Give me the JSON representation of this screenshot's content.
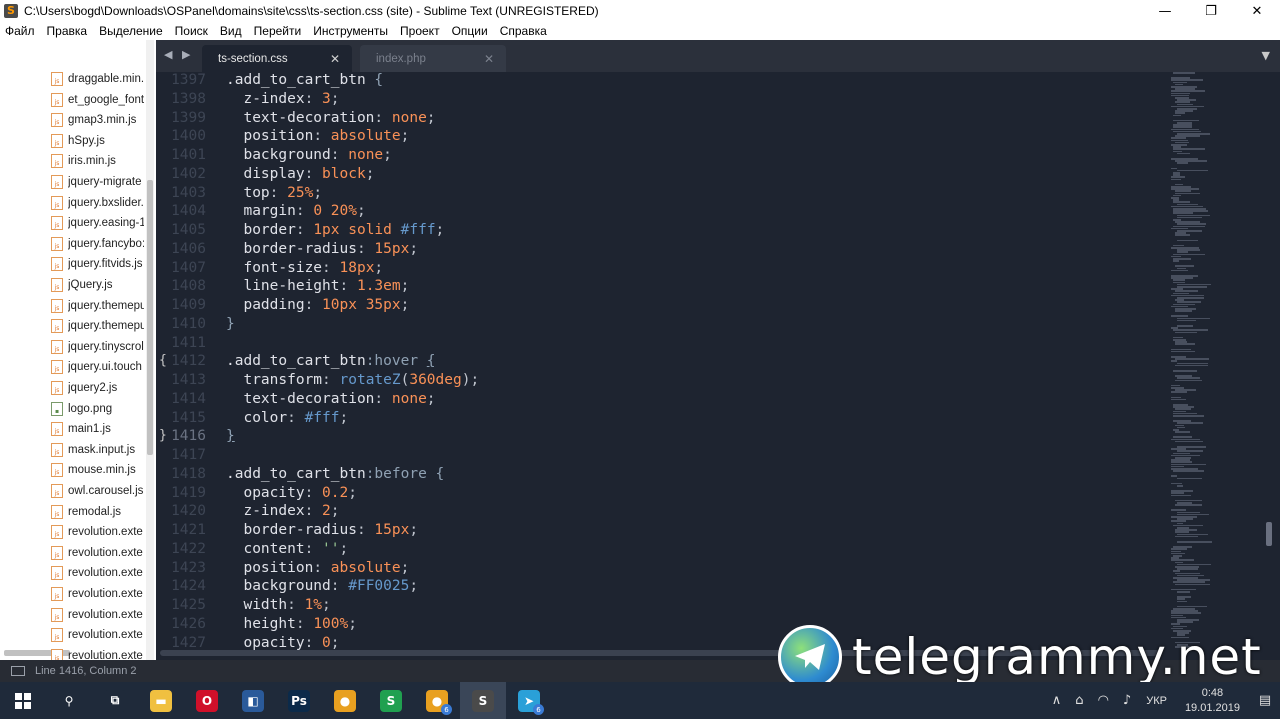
{
  "window": {
    "title": "C:\\Users\\bogd\\Downloads\\OSPanel\\domains\\site\\css\\ts-section.css (site) - Sublime Text (UNREGISTERED)",
    "minimize": "—",
    "maximize": "❐",
    "close": "✕"
  },
  "menu": [
    "Файл",
    "Правка",
    "Выделение",
    "Поиск",
    "Вид",
    "Перейти",
    "Инструменты",
    "Проект",
    "Опции",
    "Справка"
  ],
  "sidebar": {
    "files": [
      {
        "name": "draggable.min.",
        "type": "js"
      },
      {
        "name": "et_google_font",
        "type": "js"
      },
      {
        "name": "gmap3.min.js",
        "type": "js"
      },
      {
        "name": "hSpy.js",
        "type": "js"
      },
      {
        "name": "iris.min.js",
        "type": "js"
      },
      {
        "name": "jquery-migrate",
        "type": "js"
      },
      {
        "name": "jquery.bxslider.",
        "type": "js"
      },
      {
        "name": "jquery.easing-1",
        "type": "js"
      },
      {
        "name": "jquery.fancybo:",
        "type": "js"
      },
      {
        "name": "jquery.fitvids.js",
        "type": "js"
      },
      {
        "name": "jQuery.js",
        "type": "js"
      },
      {
        "name": "jquery.themepu",
        "type": "js"
      },
      {
        "name": "jquery.themepu",
        "type": "js"
      },
      {
        "name": "jquery.tinyscrol",
        "type": "js"
      },
      {
        "name": "jquery.ui.touch",
        "type": "js"
      },
      {
        "name": "jquery2.js",
        "type": "js"
      },
      {
        "name": "logo.png",
        "type": "img"
      },
      {
        "name": "main1.js",
        "type": "js"
      },
      {
        "name": "mask.input.js",
        "type": "js"
      },
      {
        "name": "mouse.min.js",
        "type": "js"
      },
      {
        "name": "owl.carousel.js",
        "type": "js"
      },
      {
        "name": "remodal.js",
        "type": "js"
      },
      {
        "name": "revolution.exte",
        "type": "js"
      },
      {
        "name": "revolution.exte",
        "type": "js"
      },
      {
        "name": "revolution.exte",
        "type": "js"
      },
      {
        "name": "revolution.exte",
        "type": "js"
      },
      {
        "name": "revolution.exte",
        "type": "js"
      },
      {
        "name": "revolution.exte",
        "type": "js"
      },
      {
        "name": "revolution.exte",
        "type": "js"
      }
    ]
  },
  "tabs": {
    "nav": "◀ ▶",
    "active": "ts-section.css",
    "inactive": "index.php",
    "close": "✕",
    "dropdown": "▼"
  },
  "editor": {
    "lines": [
      {
        "n": "1397",
        "tokens": [
          {
            "t": ".add_to_cart_btn ",
            "c": "t-sel"
          },
          {
            "t": "{",
            "c": "t-brace"
          }
        ]
      },
      {
        "n": "1398",
        "tokens": [
          {
            "t": "  z-index",
            "c": "t-prop"
          },
          {
            "t": ": ",
            "c": "t-punc"
          },
          {
            "t": "3",
            "c": "t-val"
          },
          {
            "t": ";",
            "c": "t-punc"
          }
        ]
      },
      {
        "n": "1399",
        "tokens": [
          {
            "t": "  text-decoration",
            "c": "t-prop"
          },
          {
            "t": ": ",
            "c": "t-punc"
          },
          {
            "t": "none",
            "c": "t-val"
          },
          {
            "t": ";",
            "c": "t-punc"
          }
        ]
      },
      {
        "n": "1400",
        "tokens": [
          {
            "t": "  position",
            "c": "t-prop"
          },
          {
            "t": ": ",
            "c": "t-punc"
          },
          {
            "t": "absolute",
            "c": "t-val"
          },
          {
            "t": ";",
            "c": "t-punc"
          }
        ]
      },
      {
        "n": "1401",
        "tokens": [
          {
            "t": "  background",
            "c": "t-prop"
          },
          {
            "t": ": ",
            "c": "t-punc"
          },
          {
            "t": "none",
            "c": "t-val"
          },
          {
            "t": ";",
            "c": "t-punc"
          }
        ]
      },
      {
        "n": "1402",
        "tokens": [
          {
            "t": "  display",
            "c": "t-prop"
          },
          {
            "t": ": ",
            "c": "t-punc"
          },
          {
            "t": "block",
            "c": "t-val"
          },
          {
            "t": ";",
            "c": "t-punc"
          }
        ]
      },
      {
        "n": "1403",
        "tokens": [
          {
            "t": "  top",
            "c": "t-prop"
          },
          {
            "t": ": ",
            "c": "t-punc"
          },
          {
            "t": "25%",
            "c": "t-val"
          },
          {
            "t": ";",
            "c": "t-punc"
          }
        ]
      },
      {
        "n": "1404",
        "tokens": [
          {
            "t": "  margin",
            "c": "t-prop"
          },
          {
            "t": ": ",
            "c": "t-punc"
          },
          {
            "t": "0 20%",
            "c": "t-val"
          },
          {
            "t": ";",
            "c": "t-punc"
          }
        ]
      },
      {
        "n": "1405",
        "tokens": [
          {
            "t": "  border",
            "c": "t-prop"
          },
          {
            "t": ": ",
            "c": "t-punc"
          },
          {
            "t": "1px solid ",
            "c": "t-val"
          },
          {
            "t": "#fff",
            "c": "t-func"
          },
          {
            "t": ";",
            "c": "t-punc"
          }
        ]
      },
      {
        "n": "1406",
        "tokens": [
          {
            "t": "  border-radius",
            "c": "t-prop"
          },
          {
            "t": ": ",
            "c": "t-punc"
          },
          {
            "t": "15px",
            "c": "t-val"
          },
          {
            "t": ";",
            "c": "t-punc"
          }
        ]
      },
      {
        "n": "1407",
        "tokens": [
          {
            "t": "  font-size",
            "c": "t-prop"
          },
          {
            "t": ": ",
            "c": "t-punc"
          },
          {
            "t": "18px",
            "c": "t-val"
          },
          {
            "t": ";",
            "c": "t-punc"
          }
        ]
      },
      {
        "n": "1408",
        "tokens": [
          {
            "t": "  line-height",
            "c": "t-prop"
          },
          {
            "t": ": ",
            "c": "t-punc"
          },
          {
            "t": "1.3em",
            "c": "t-val"
          },
          {
            "t": ";",
            "c": "t-punc"
          }
        ]
      },
      {
        "n": "1409",
        "tokens": [
          {
            "t": "  padding",
            "c": "t-prop"
          },
          {
            "t": ": ",
            "c": "t-punc"
          },
          {
            "t": "10px 35px",
            "c": "t-val"
          },
          {
            "t": ";",
            "c": "t-punc"
          }
        ]
      },
      {
        "n": "1410",
        "tokens": [
          {
            "t": "}",
            "c": "t-brace"
          }
        ]
      },
      {
        "n": "1411",
        "tokens": []
      },
      {
        "n": "1412",
        "tokens": [
          {
            "t": ".add_to_cart_btn",
            "c": "t-sel"
          },
          {
            "t": ":hover ",
            "c": "t-pseudo"
          },
          {
            "t": "{",
            "c": "t-brace t-ul"
          }
        ],
        "mark": "{"
      },
      {
        "n": "1413",
        "tokens": [
          {
            "t": "  transform",
            "c": "t-prop"
          },
          {
            "t": ": ",
            "c": "t-punc"
          },
          {
            "t": "rotateZ",
            "c": "t-func"
          },
          {
            "t": "(",
            "c": "t-punc"
          },
          {
            "t": "360deg",
            "c": "t-val"
          },
          {
            "t": ");",
            "c": "t-punc"
          }
        ]
      },
      {
        "n": "1414",
        "tokens": [
          {
            "t": "  text-decoration",
            "c": "t-prop"
          },
          {
            "t": ": ",
            "c": "t-punc"
          },
          {
            "t": "none",
            "c": "t-val"
          },
          {
            "t": ";",
            "c": "t-punc"
          }
        ]
      },
      {
        "n": "1415",
        "tokens": [
          {
            "t": "  color",
            "c": "t-prop"
          },
          {
            "t": ": ",
            "c": "t-punc"
          },
          {
            "t": "#fff",
            "c": "t-func"
          },
          {
            "t": ";",
            "c": "t-punc"
          }
        ]
      },
      {
        "n": "1416",
        "tokens": [
          {
            "t": "}",
            "c": "t-brace t-ul"
          }
        ],
        "mark": "}",
        "current": true
      },
      {
        "n": "1417",
        "tokens": []
      },
      {
        "n": "1418",
        "tokens": [
          {
            "t": ".add_to_cart_btn",
            "c": "t-sel"
          },
          {
            "t": ":before ",
            "c": "t-pseudo"
          },
          {
            "t": "{",
            "c": "t-brace"
          }
        ]
      },
      {
        "n": "1419",
        "tokens": [
          {
            "t": "  opacity",
            "c": "t-prop"
          },
          {
            "t": ": ",
            "c": "t-punc"
          },
          {
            "t": "0.2",
            "c": "t-val"
          },
          {
            "t": ";",
            "c": "t-punc"
          }
        ]
      },
      {
        "n": "1420",
        "tokens": [
          {
            "t": "  z-index",
            "c": "t-prop"
          },
          {
            "t": ": ",
            "c": "t-punc"
          },
          {
            "t": "2",
            "c": "t-val"
          },
          {
            "t": ";",
            "c": "t-punc"
          }
        ]
      },
      {
        "n": "1421",
        "tokens": [
          {
            "t": "  border-radius",
            "c": "t-prop"
          },
          {
            "t": ": ",
            "c": "t-punc"
          },
          {
            "t": "15px",
            "c": "t-val"
          },
          {
            "t": ";",
            "c": "t-punc"
          }
        ]
      },
      {
        "n": "1422",
        "tokens": [
          {
            "t": "  content",
            "c": "t-prop"
          },
          {
            "t": ": ",
            "c": "t-punc"
          },
          {
            "t": "''",
            "c": "t-str"
          },
          {
            "t": ";",
            "c": "t-punc"
          }
        ]
      },
      {
        "n": "1423",
        "tokens": [
          {
            "t": "  position",
            "c": "t-prop"
          },
          {
            "t": ": ",
            "c": "t-punc"
          },
          {
            "t": "absolute",
            "c": "t-val"
          },
          {
            "t": ";",
            "c": "t-punc"
          }
        ]
      },
      {
        "n": "1424",
        "tokens": [
          {
            "t": "  background",
            "c": "t-prop"
          },
          {
            "t": ": ",
            "c": "t-punc"
          },
          {
            "t": "#FF0025",
            "c": "t-func"
          },
          {
            "t": ";",
            "c": "t-punc"
          }
        ]
      },
      {
        "n": "1425",
        "tokens": [
          {
            "t": "  width",
            "c": "t-prop"
          },
          {
            "t": ": ",
            "c": "t-punc"
          },
          {
            "t": "1%",
            "c": "t-val"
          },
          {
            "t": ";",
            "c": "t-punc"
          }
        ]
      },
      {
        "n": "1426",
        "tokens": [
          {
            "t": "  height",
            "c": "t-prop"
          },
          {
            "t": ": ",
            "c": "t-punc"
          },
          {
            "t": "100%",
            "c": "t-val"
          },
          {
            "t": ";",
            "c": "t-punc"
          }
        ]
      },
      {
        "n": "1427",
        "tokens": [
          {
            "t": "  opacity",
            "c": "t-prop"
          },
          {
            "t": ": ",
            "c": "t-punc"
          },
          {
            "t": "0",
            "c": "t-val"
          },
          {
            "t": ";",
            "c": "t-punc"
          }
        ]
      }
    ]
  },
  "status": {
    "position": "Line 1416, Column 2"
  },
  "watermark": {
    "text": "telegrammy.net"
  },
  "taskbar": {
    "apps": [
      {
        "name": "search",
        "glyph": "⚲",
        "color": "#1f2a3a"
      },
      {
        "name": "task-view",
        "glyph": "⧉",
        "color": "#1f2a3a"
      },
      {
        "name": "file-explorer",
        "glyph": "▬",
        "color": "#f0c040"
      },
      {
        "name": "opera",
        "glyph": "O",
        "color": "#d0102a"
      },
      {
        "name": "notes",
        "glyph": "◧",
        "color": "#2a5a9a"
      },
      {
        "name": "photoshop",
        "glyph": "Ps",
        "color": "#0b2a4a"
      },
      {
        "name": "chrome",
        "glyph": "●",
        "color": "#e8a020"
      },
      {
        "name": "s-app",
        "glyph": "S",
        "color": "#20a050"
      },
      {
        "name": "chrome-2",
        "glyph": "●",
        "color": "#e8a020",
        "badge": "6"
      },
      {
        "name": "sublime",
        "glyph": "S",
        "color": "#4a4a4a",
        "active": true
      },
      {
        "name": "telegram",
        "glyph": "➤",
        "color": "#2aa0d8",
        "badge": "6"
      }
    ],
    "lang": "УКР",
    "time": "0:48",
    "date": "19.01.2019"
  }
}
